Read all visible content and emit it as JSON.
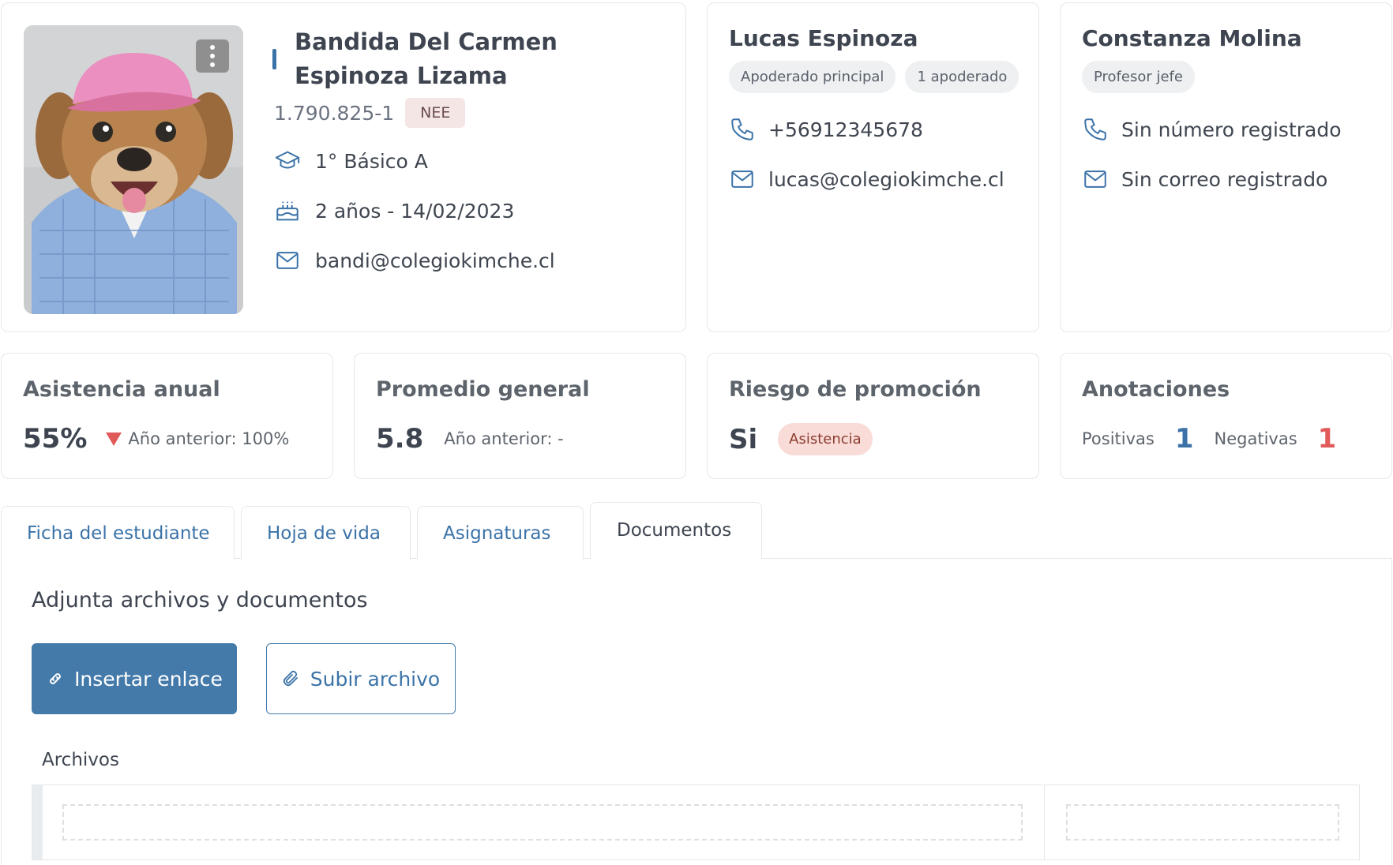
{
  "student": {
    "name": "Bandida Del Carmen Espinoza Lizama",
    "rut": "1.790.825-1",
    "badge": "NEE",
    "course": "1° Básico A",
    "age_birth": "2 años - 14/02/2023",
    "email": "bandi@colegiokimche.cl"
  },
  "guardian": {
    "name": "Lucas Espinoza",
    "tags": [
      "Apoderado principal",
      "1 apoderado"
    ],
    "phone": "+56912345678",
    "email": "lucas@colegiokimche.cl"
  },
  "teacher": {
    "name": "Constanza Molina",
    "tags": [
      "Profesor jefe"
    ],
    "phone": "Sin número registrado",
    "email": "Sin correo registrado"
  },
  "stats": {
    "attendance": {
      "title": "Asistencia anual",
      "value": "55%",
      "previous": "Año anterior: 100%"
    },
    "average": {
      "title": "Promedio general",
      "value": "5.8",
      "previous": "Año anterior: -"
    },
    "risk": {
      "title": "Riesgo de promoción",
      "value": "Si",
      "badge": "Asistencia"
    },
    "notes": {
      "title": "Anotaciones",
      "positive_label": "Positivas",
      "positive": "1",
      "negative_label": "Negativas",
      "negative": "1"
    }
  },
  "tabs": [
    {
      "label": "Ficha del estudiante"
    },
    {
      "label": "Hoja de vida"
    },
    {
      "label": "Asignaturas"
    },
    {
      "label": "Documentos",
      "active": true
    }
  ],
  "documents": {
    "title": "Adjunta archivos y documentos",
    "insert_link": "Insertar enlace",
    "upload_file": "Subir archivo",
    "files_label": "Archivos"
  },
  "colors": {
    "accent": "#447aa9",
    "negative": "#e05a5a",
    "risk_badge_bg": "#f9dcd8"
  }
}
